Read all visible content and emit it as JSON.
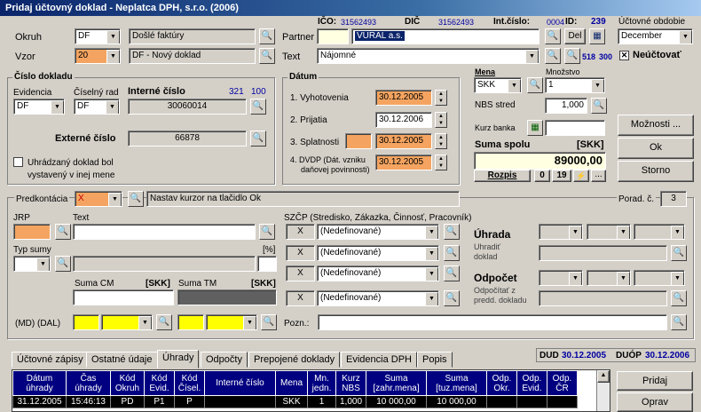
{
  "window": {
    "title": "Pridaj účtovný doklad - Neplatca DPH, s.r.o. (2006)"
  },
  "header": {
    "ico_label": "IČO:",
    "ico_value": "31562493",
    "dic_label": "DIČ",
    "dic_value": "31562493",
    "int_cislo_label": "Int.číslo:",
    "int_cislo_value": "0004",
    "id_label": "ID:",
    "id_value": "239",
    "obdobie_label": "Účtovné obdobie",
    "obdobie_value": "December",
    "neuctovat_label": "Neúčtovať"
  },
  "left": {
    "okruh_label": "Okruh",
    "okruh_code": "DF",
    "okruh_name": "Došlé faktúry",
    "vzor_label": "Vzor",
    "vzor_code": "20",
    "vzor_name": "DF - Nový doklad"
  },
  "partner": {
    "label": "Partner",
    "value": "VURAL a.s.",
    "del_label": "Del"
  },
  "text": {
    "label": "Text",
    "value": "Nájomné",
    "code_a": "518",
    "code_b": "300"
  },
  "cislo_dokladu": {
    "title": "Číslo dokladu",
    "evidencia_label": "Evidencia",
    "evidencia_value": "DF",
    "ciselny_rad_label": "Číselný rad",
    "ciselny_rad_value": "DF",
    "interne_label": "Interné číslo",
    "interne_value": "30060014",
    "num_a": "321",
    "num_b": "100",
    "externe_label": "Externé číslo",
    "externe_value": "66878",
    "uhradzany_label_1": "Uhrádzaný doklad bol",
    "uhradzany_label_2": "vystavený v inej mene"
  },
  "datum": {
    "title": "Dátum",
    "rows": [
      {
        "label": "1. Vyhotovenia",
        "value": "30.12.2005"
      },
      {
        "label": "2. Prijatia",
        "value": "30.12.2006"
      },
      {
        "label": "3. Splatnosti",
        "value": "30.12.2005"
      },
      {
        "label": "4. DVDP (Dát. vzniku",
        "label2": "daňovej povinnosti)",
        "value": "30.12.2005"
      }
    ]
  },
  "mena": {
    "mena_label": "Mena",
    "mena_value": "SKK",
    "mnozstvo_label": "Množstvo",
    "mnozstvo_value": "1",
    "nbs_label": "NBS stred",
    "nbs_value": "1,000",
    "kurz_label": "Kurz banka",
    "kurz_value": "",
    "suma_label": "Suma spolu",
    "suma_currency": "[SKK]",
    "suma_value": "89000,00",
    "rozpis_label": "Rozpis",
    "b0": "0",
    "b19": "19",
    "bdots": "..."
  },
  "buttons": {
    "moznosti": "Možnosti ...",
    "ok": "Ok",
    "storno": "Storno",
    "pridaj": "Pridaj",
    "oprav": "Oprav"
  },
  "predkontacia": {
    "label": "Predkontácia",
    "value": "X",
    "hint": "Nastav kurzor na tlačidlo Ok",
    "porad_label": "Porad. č.",
    "porad_value": "3"
  },
  "lower": {
    "jrp_label": "JRP",
    "text_label": "Text",
    "typ_sumy_label": "Typ sumy",
    "pct_label": "[%]",
    "suma_cm_label": "Suma CM",
    "suma_cm_cur": "[SKK]",
    "suma_tm_label": "Suma TM",
    "suma_tm_cur": "[SKK]",
    "md_dal_label": "(MD) (DAL)",
    "pozn_label": "Pozn.:"
  },
  "szcp": {
    "label": "SZČP (Stredisko, Zákazka, Činnosť, Pracovník)",
    "rows": [
      {
        "x": "X",
        "value": "(Nedefinované)"
      },
      {
        "x": "X",
        "value": "(Nedefinované)"
      },
      {
        "x": "X",
        "value": "(Nedefinované)"
      },
      {
        "x": "X",
        "value": "(Nedefinované)"
      }
    ]
  },
  "uhrada": {
    "title": "Úhrada",
    "sub1": "Uhradiť",
    "sub2": "doklad",
    "odpocet_title": "Odpočet",
    "odp_sub1": "Odpočítať z",
    "odp_sub2": "predd. dokladu"
  },
  "tabs": [
    {
      "label": "Účtovné zápisy"
    },
    {
      "label": "Ostatné údaje"
    },
    {
      "label": "Úhrady"
    },
    {
      "label": "Odpočty"
    },
    {
      "label": "Prepojené doklady"
    },
    {
      "label": "Evidencia DPH"
    },
    {
      "label": "Popis"
    }
  ],
  "dud": {
    "dud_label": "DUD",
    "dud_value": "30.12.2005",
    "duop_label": "DUÓP",
    "duop_value": "30.12.2006"
  },
  "table": {
    "headers": [
      "Dátum úhrady",
      "Čas úhrady",
      "Kód Okruh",
      "Kód Evid.",
      "Kód Čísel.",
      "Interné číslo",
      "Mena",
      "Mn. jedn.",
      "Kurz NBS",
      "Suma [zahr.mena]",
      "Suma [tuz.mena]",
      "Odp. Okr.",
      "Odp. Evid.",
      "Odp. ČR"
    ],
    "rows": [
      [
        "31.12.2005",
        "15:46:13",
        "PD",
        "P1",
        "P",
        "",
        "SKK",
        "1",
        "1,000",
        "10 000,00",
        "10 000,00",
        "",
        "",
        ""
      ]
    ]
  },
  "colors": {
    "title_bar": "#0a246a",
    "orange": "#f4a460",
    "yellow": "#ffff00",
    "header_blue": "#000080"
  }
}
